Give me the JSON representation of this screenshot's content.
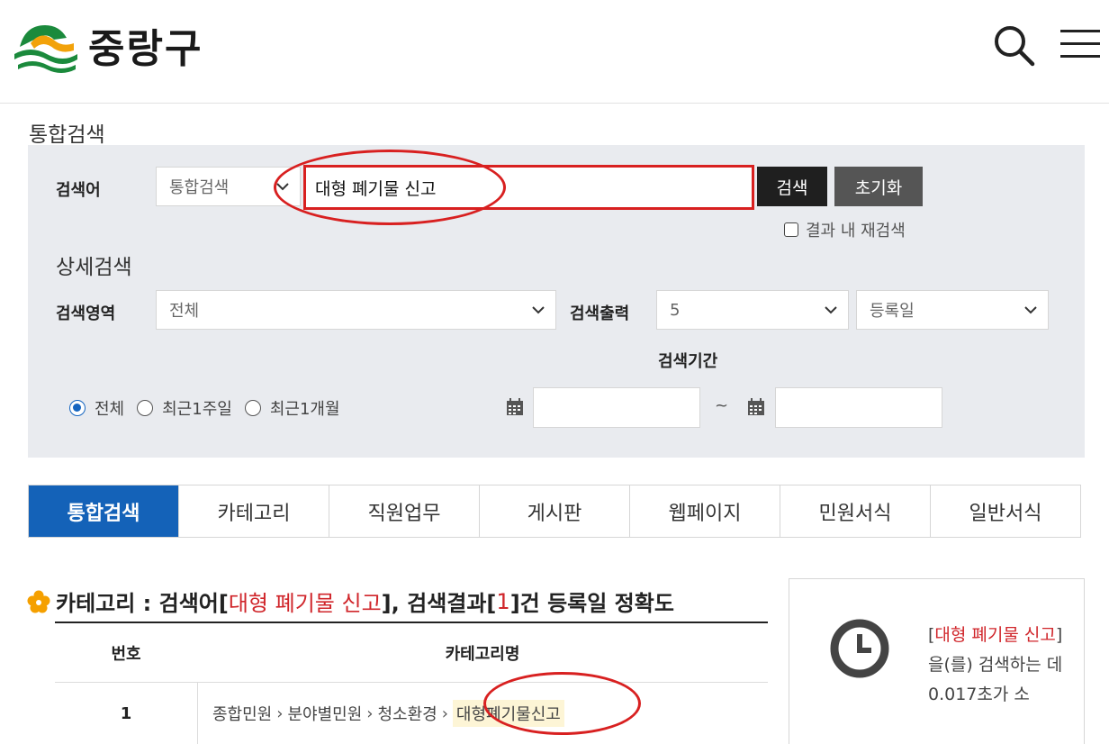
{
  "header": {
    "logo_text": "중랑구",
    "logo_icon": "jungnang-logo-icon",
    "search_icon": "search-icon",
    "menu_icon": "hamburger-menu-icon"
  },
  "page_title": "통합검색",
  "search": {
    "keyword_label": "검색어",
    "scope_value": "통합검색",
    "keyword_value": "대형 폐기물 신고",
    "search_button": "검색",
    "reset_button": "초기화",
    "research_label": "결과 내 재검색"
  },
  "detail": {
    "title": "상세검색",
    "area_label": "검색영역",
    "area_value": "전체",
    "output_label": "검색출력",
    "output_value": "5",
    "sort_value": "등록일",
    "period_label": "검색기간",
    "period_options": [
      "전체",
      "최근1주일",
      "최근1개월"
    ],
    "period_selected": "전체",
    "tilde": "~"
  },
  "tabs": [
    "통합검색",
    "카테고리",
    "직원업무",
    "게시판",
    "웹페이지",
    "민원서식",
    "일반서식"
  ],
  "result": {
    "prefix": "카테고리 : 검색어[",
    "keyword": "대형 폐기물 신고",
    "mid": "], 검색결과[",
    "count": "1",
    "suffix": "]건 등록일 정확도",
    "columns": [
      "번호",
      "카테고리명"
    ],
    "rows": [
      {
        "no": "1",
        "path": [
          "종합민원",
          "분야별민원",
          "청소환경"
        ],
        "highlight": "대형폐기물신고"
      }
    ]
  },
  "sidebar": {
    "bracket_open": "[",
    "keyword": "대형 폐기물 신고",
    "text": "]을(를) 검색하는 데 0.017초가 소",
    "clock_icon": "clock-icon"
  },
  "colors": {
    "accent": "#1462b8",
    "highlight_red": "#d82020",
    "panel_bg": "#e9ebef"
  }
}
